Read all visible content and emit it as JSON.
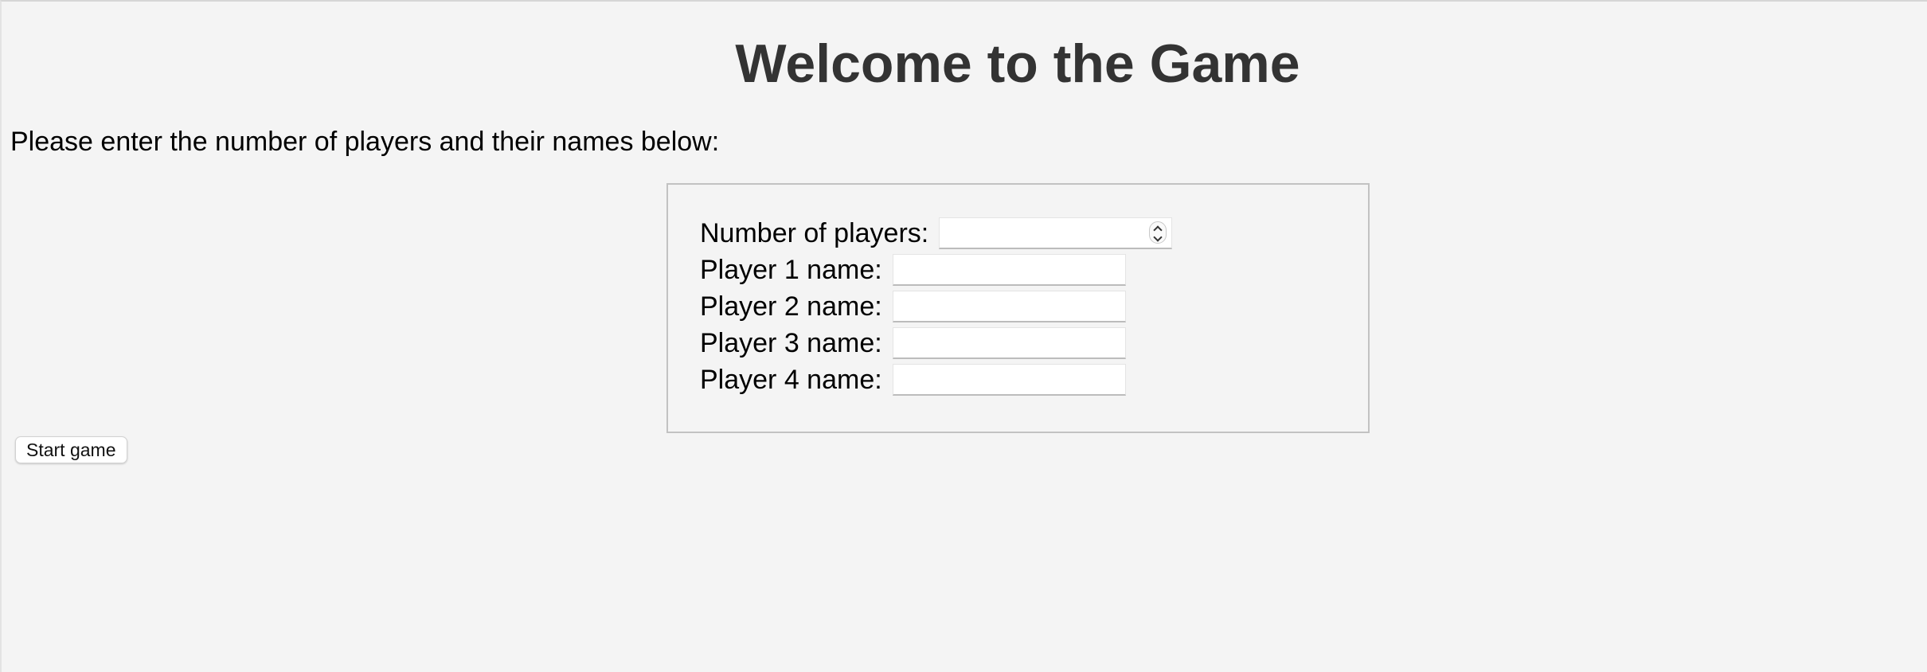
{
  "page": {
    "title": "Welcome to the Game",
    "instructions": "Please enter the number of players and their names below:"
  },
  "form": {
    "num_players": {
      "label": "Number of players:",
      "value": ""
    },
    "players": [
      {
        "label": "Player 1 name:",
        "value": ""
      },
      {
        "label": "Player 2 name:",
        "value": ""
      },
      {
        "label": "Player 3 name:",
        "value": ""
      },
      {
        "label": "Player 4 name:",
        "value": ""
      }
    ]
  },
  "actions": {
    "start_label": "Start game"
  },
  "colors": {
    "background": "#f4f4f4",
    "title": "#333333",
    "form_border": "#c2c2c2"
  }
}
